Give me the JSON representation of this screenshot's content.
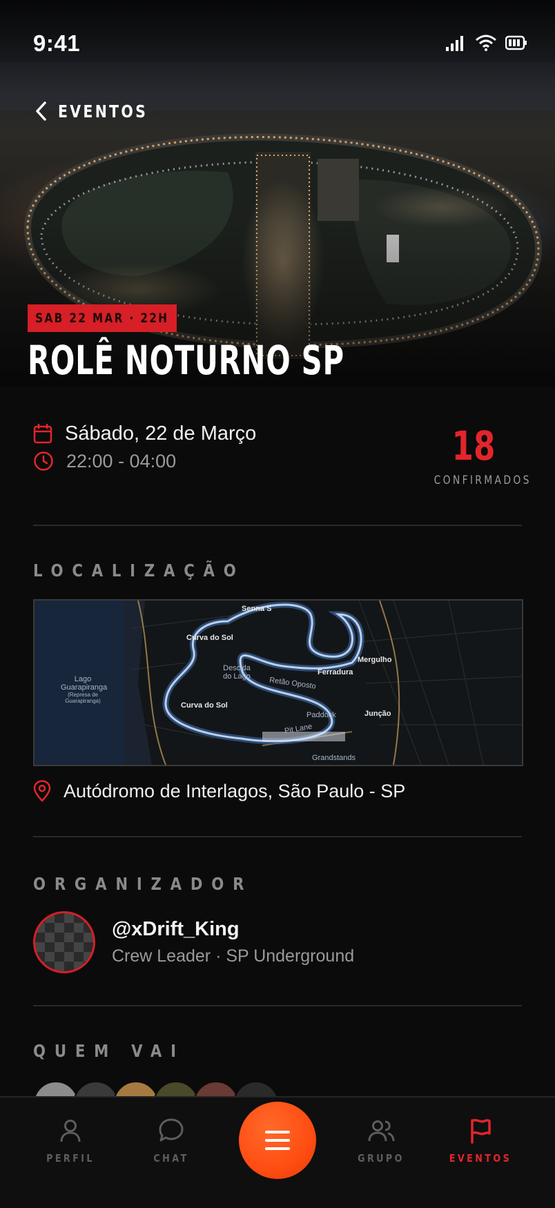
{
  "status_bar": {
    "time": "9:41",
    "icons": [
      "signal-icon",
      "wifi-icon",
      "battery-icon"
    ]
  },
  "nav": {
    "back_label": "EVENTOS"
  },
  "event": {
    "date_tag": "SAB 22 MAR · 22H",
    "title": "ROLÊ NOTURNO SP",
    "date": "Sábado, 22 de Março",
    "time": "22:00 - 04:00",
    "confirmed_count": "18",
    "confirmed_label": "CONFIRMADOS"
  },
  "location": {
    "section_label": "LOCALIZAÇÃO",
    "address": "Autódromo de Interlagos, São Paulo - SP",
    "map_labels": [
      "Senna S",
      "Curva do Sol",
      "Descida do Lago",
      "Ferradura",
      "Mergulho",
      "Retão Oposto",
      "Lago Guarapiranga",
      "(Represa de Guarapiranga)",
      "Curva do Sol",
      "Paddock",
      "Junção",
      "Pit Lane",
      "Grandstands"
    ]
  },
  "organizer": {
    "section_label": "ORGANIZADOR",
    "handle": "@xDrift_King",
    "subtitle": "Crew Leader · SP Underground"
  },
  "attendees": {
    "section_label": "QUEM VAI"
  },
  "tabbar": {
    "tabs": [
      {
        "label": "PERFIL",
        "icon": "person-icon"
      },
      {
        "label": "CHAT",
        "icon": "chat-bubble-icon"
      },
      {
        "label": "GRUPO",
        "icon": "group-icon"
      },
      {
        "label": "EVENTOS",
        "icon": "flag-icon",
        "active": true
      }
    ],
    "center_button_icon": "menu-icon"
  },
  "colors": {
    "accent": "#d61f26",
    "fab": "#ff4d12",
    "background": "#0b0b0b"
  }
}
